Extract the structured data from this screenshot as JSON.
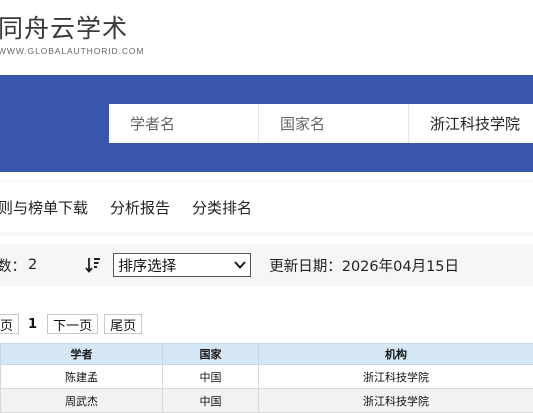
{
  "brand": {
    "title": "同舟云学术",
    "subtitle": "WWW.GLOBALAUTHORID.COM"
  },
  "search": {
    "scholar_placeholder": "学者名",
    "country_placeholder": "国家名",
    "institution_value": "浙江科技学院"
  },
  "nav": {
    "items": [
      "则与榜单下载",
      "分析报告",
      "分类排名"
    ]
  },
  "filter": {
    "count_label": "数：",
    "count_value": "2",
    "sort_icon": "sort-descending-icon",
    "sort_selected": "排序选择",
    "update_label": "更新日期：",
    "update_date": "2026年04月15日"
  },
  "pager": {
    "first": "页",
    "current": "1",
    "next": "下一页",
    "last": "尾页"
  },
  "table": {
    "headers": [
      "学者",
      "国家",
      "机构"
    ],
    "rows": [
      [
        "陈建孟",
        "中国",
        "浙江科技学院"
      ],
      [
        "周武杰",
        "中国",
        "浙江科技学院"
      ]
    ]
  },
  "colors": {
    "banner": "#3756ac",
    "table_header": "#d5e7f5"
  }
}
